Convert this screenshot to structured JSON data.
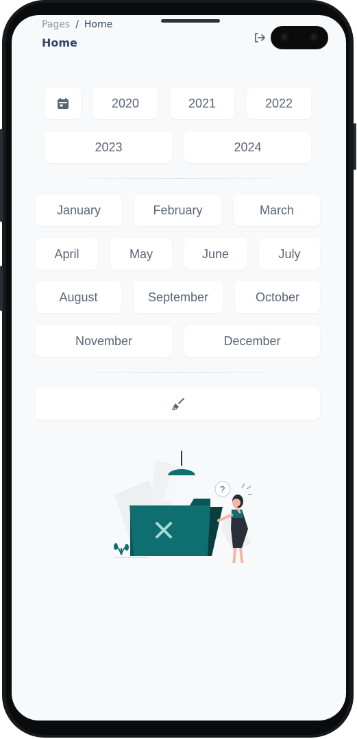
{
  "breadcrumb": {
    "root": "Pages",
    "separator": "/",
    "current": "Home"
  },
  "page_title": "Home",
  "icons": {
    "logout": "logout-icon",
    "calendar": "calendar-icon",
    "clear": "broom-icon",
    "illustration": "empty-folder-illustration"
  },
  "years": [
    "2020",
    "2021",
    "2022",
    "2023",
    "2024"
  ],
  "months": [
    "January",
    "February",
    "March",
    "April",
    "May",
    "June",
    "July",
    "August",
    "September",
    "October",
    "November",
    "December"
  ],
  "colors": {
    "accent": "#0f6f70",
    "text": "#344767",
    "muted": "#8a94a6",
    "background": "#f8f9fa"
  }
}
